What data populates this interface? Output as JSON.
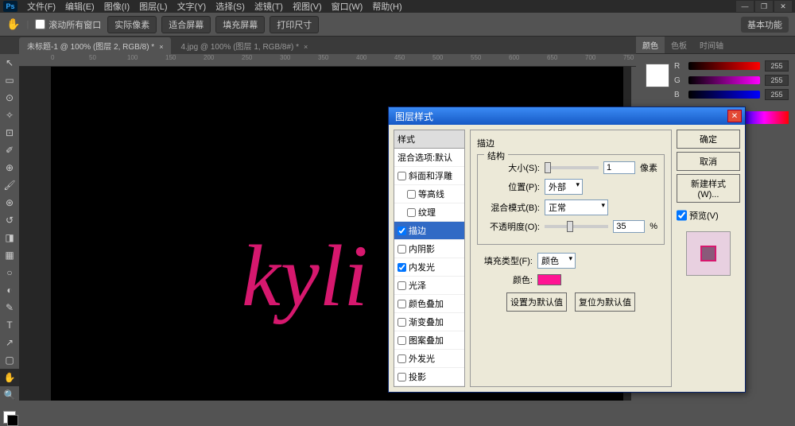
{
  "app": {
    "logo": "Ps"
  },
  "menu": [
    "文件(F)",
    "编辑(E)",
    "图像(I)",
    "图层(L)",
    "文字(Y)",
    "选择(S)",
    "滤镜(T)",
    "视图(V)",
    "窗口(W)",
    "帮助(H)"
  ],
  "options": {
    "scroll_all": "滚动所有窗口",
    "buttons": [
      "实际像素",
      "适合屏幕",
      "填充屏幕",
      "打印尺寸"
    ],
    "right_label": "基本功能"
  },
  "tabs": [
    {
      "label": "未标题-1 @ 100% (图层 2, RGB/8) *",
      "active": true
    },
    {
      "label": "4.jpg @ 100% (图层 1, RGB/8#) *",
      "active": false
    }
  ],
  "ruler": [
    0,
    50,
    100,
    150,
    200,
    250,
    300,
    350,
    400,
    450,
    500,
    550,
    600,
    650,
    700,
    750
  ],
  "canvas": {
    "text": "kyli"
  },
  "color_panel": {
    "tabs": [
      "颜色",
      "色板",
      "时间轴"
    ],
    "channels": [
      {
        "label": "R",
        "value": "255",
        "cls": "slider-r"
      },
      {
        "label": "G",
        "value": "255",
        "cls": "slider-g"
      },
      {
        "label": "B",
        "value": "255",
        "cls": "slider-b"
      }
    ]
  },
  "dialog": {
    "title": "图层样式",
    "styles_header": "样式",
    "blend_default": "混合选项:默认",
    "style_list": [
      {
        "label": "斜面和浮雕",
        "checked": false
      },
      {
        "label": "等高线",
        "checked": false,
        "indent": true
      },
      {
        "label": "纹理",
        "checked": false,
        "indent": true
      },
      {
        "label": "描边",
        "checked": true,
        "selected": true
      },
      {
        "label": "内阴影",
        "checked": false
      },
      {
        "label": "内发光",
        "checked": true
      },
      {
        "label": "光泽",
        "checked": false
      },
      {
        "label": "颜色叠加",
        "checked": false
      },
      {
        "label": "渐变叠加",
        "checked": false
      },
      {
        "label": "图案叠加",
        "checked": false
      },
      {
        "label": "外发光",
        "checked": false
      },
      {
        "label": "投影",
        "checked": false
      }
    ],
    "section_title": "描边",
    "structure_label": "结构",
    "size_label": "大小(S):",
    "size_value": "1",
    "size_unit": "像素",
    "position_label": "位置(P):",
    "position_value": "外部",
    "blend_label": "混合模式(B):",
    "blend_value": "正常",
    "opacity_label": "不透明度(O):",
    "opacity_value": "35",
    "opacity_unit": "%",
    "fill_type_label": "填充类型(F):",
    "fill_type_value": "颜色",
    "color_label": "颜色:",
    "color_value": "#ff1493",
    "default_btn": "设置为默认值",
    "reset_btn": "复位为默认值",
    "ok": "确定",
    "cancel": "取消",
    "new_style": "新建样式(W)...",
    "preview_label": "预览(V)"
  }
}
